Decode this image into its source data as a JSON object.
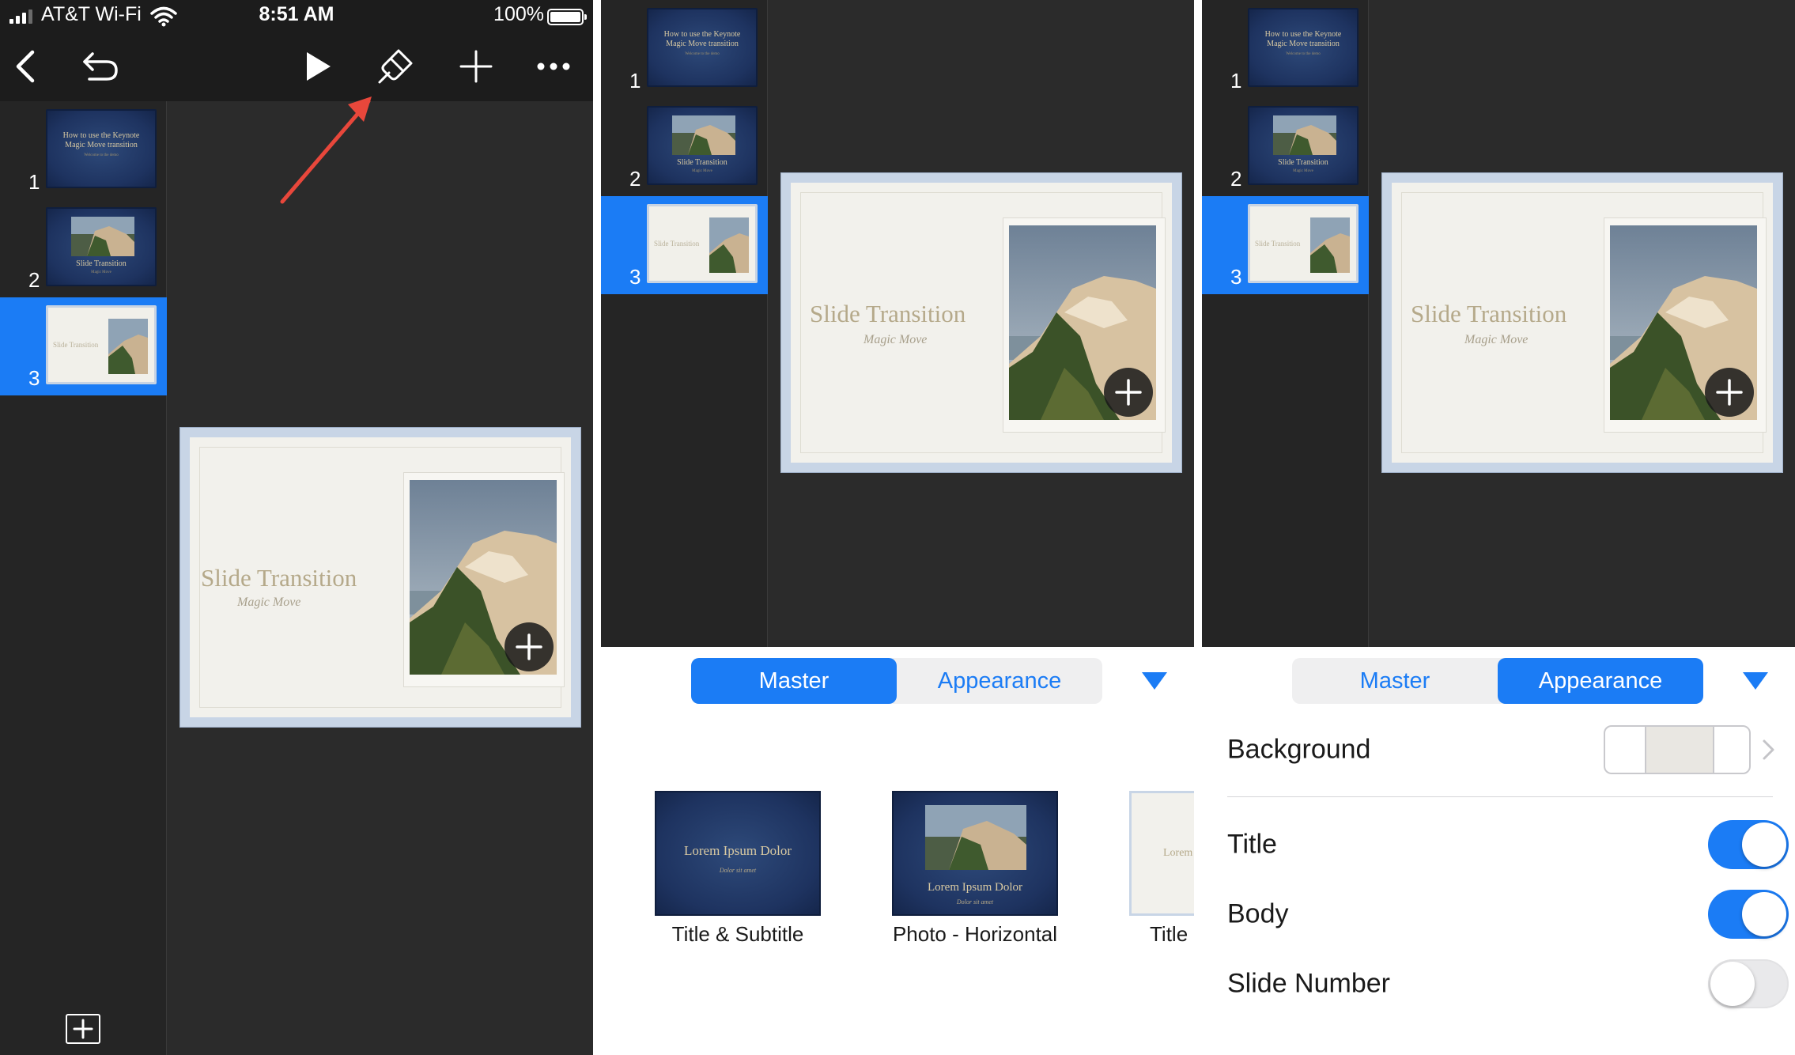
{
  "status": {
    "carrier": "AT&T Wi-Fi",
    "time": "8:51 AM",
    "battery": "100%"
  },
  "slides": [
    {
      "number": "1",
      "title_line1": "How to use the Keynote",
      "title_line2": "Magic Move transition",
      "tiny": "Welcome to the demo"
    },
    {
      "number": "2",
      "caption": "Slide Transition",
      "tiny": "Magic Move"
    },
    {
      "number": "3",
      "caption": "Slide Transition",
      "tiny": "Magic Move"
    }
  ],
  "main_slide": {
    "title": "Slide Transition",
    "subtitle": "Magic Move"
  },
  "segments": {
    "master": "Master",
    "appearance": "Appearance"
  },
  "masters": [
    {
      "label": "Title & Subtitle",
      "thumb_title": "Lorem Ipsum Dolor",
      "thumb_sub": "Dolor sit amet"
    },
    {
      "label": "Photo - Horizontal",
      "thumb_title": "Lorem Ipsum Dolor",
      "thumb_sub": "Dolor sit amet"
    },
    {
      "label": "Title",
      "thumb_title": "Lorem"
    }
  ],
  "appearance": {
    "background_label": "Background",
    "rows": [
      {
        "label": "Title",
        "on": true
      },
      {
        "label": "Body",
        "on": true
      },
      {
        "label": "Slide Number",
        "on": false
      }
    ]
  },
  "colors": {
    "accent": "#1b7cf5",
    "dark_bg": "#2b2b2b",
    "slide_navy": "#1e3360",
    "slide_border": "#c8d5e6",
    "annotation_arrow": "#e8473b"
  },
  "icons": [
    "back-chevron-icon",
    "undo-icon",
    "play-icon",
    "paintbrush-icon",
    "plus-icon",
    "more-icon",
    "add-slide-icon",
    "dropdown-triangle-icon",
    "chevron-right-icon"
  ]
}
